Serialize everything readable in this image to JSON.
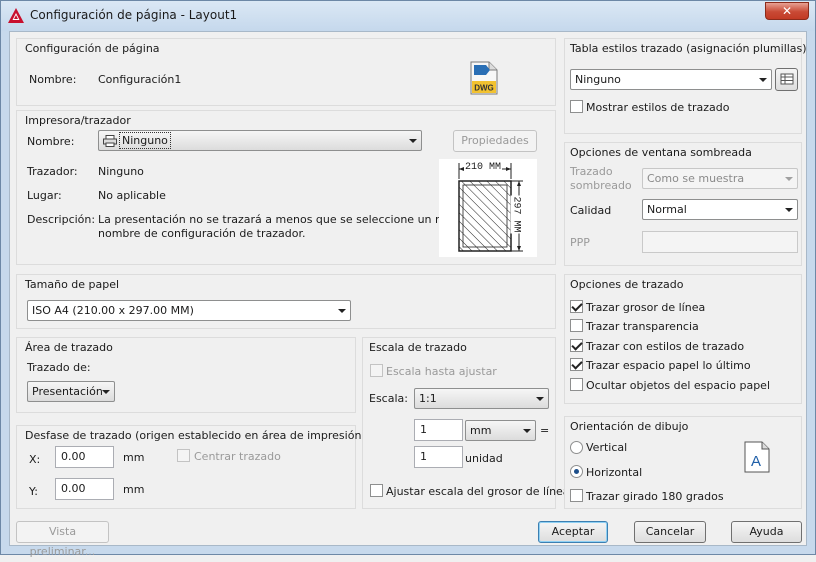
{
  "window": {
    "title": "Configuración de página - Layout1",
    "close_label": "✕"
  },
  "page_setup": {
    "heading": "Configuración de página",
    "name_label": "Nombre:",
    "name_value": "Configuración1",
    "dwg_icon_text": "DWG"
  },
  "printer": {
    "heading": "Impresora/trazador",
    "name_label": "Nombre:",
    "name_value": "Ninguno",
    "properties_button": "Propiedades",
    "plotter_label": "Trazador:",
    "plotter_value": "Ninguno",
    "location_label": "Lugar:",
    "location_value": "No aplicable",
    "description_label": "Descripción:",
    "description_line1": "La presentación no se trazará a menos que se seleccione un nuevo",
    "description_line2": "nombre de configuración de trazador.",
    "preview_width": "210 MM",
    "preview_height": "297 MM"
  },
  "paper_size": {
    "heading": "Tamaño de papel",
    "value": "ISO A4 (210.00 x 297.00 MM)"
  },
  "plot_area": {
    "heading": "Área de trazado",
    "what_label": "Trazado de:",
    "what_value": "Presentación"
  },
  "plot_offset": {
    "heading": "Desfase de trazado (origen establecido en área de impresión)",
    "x_label": "X:",
    "x_value": "0.00",
    "x_unit": "mm",
    "y_label": "Y:",
    "y_value": "0.00",
    "y_unit": "mm",
    "center_label": "Centrar trazado"
  },
  "plot_scale": {
    "heading": "Escala de trazado",
    "fit_label": "Escala hasta ajustar",
    "scale_label": "Escala:",
    "scale_value": "1:1",
    "value1": "1",
    "unit_value": "mm",
    "equals": "=",
    "value2": "1",
    "unit2_label": "unidad",
    "lineweights_label": "Ajustar escala del grosor de línea"
  },
  "plot_style_table": {
    "heading": "Tabla estilos trazado (asignación plumillas)",
    "value": "Ninguno",
    "show_styles_label": "Mostrar estilos de trazado"
  },
  "shaded_viewport": {
    "heading": "Opciones de ventana sombreada",
    "shade_label_line1": "Trazado",
    "shade_label_line2": "sombreado",
    "shade_value": "Como se muestra",
    "quality_label": "Calidad",
    "quality_value": "Normal",
    "dpi_label": "PPP"
  },
  "plot_options": {
    "heading": "Opciones de trazado",
    "items": [
      {
        "label": "Trazar grosor de línea",
        "checked": true
      },
      {
        "label": "Trazar transparencia",
        "checked": false
      },
      {
        "label": "Trazar con estilos de trazado",
        "checked": true
      },
      {
        "label": "Trazar espacio papel lo último",
        "checked": true
      },
      {
        "label": "Ocultar objetos del espacio papel",
        "checked": false
      }
    ]
  },
  "orientation": {
    "heading": "Orientación de dibujo",
    "portrait_label": "Vertical",
    "landscape_label": "Horizontal",
    "upside_down_label": "Trazar girado 180 grados",
    "icon_letter": "A"
  },
  "buttons": {
    "preview": "Vista preliminar...",
    "ok": "Aceptar",
    "cancel": "Cancelar",
    "help": "Ayuda"
  }
}
